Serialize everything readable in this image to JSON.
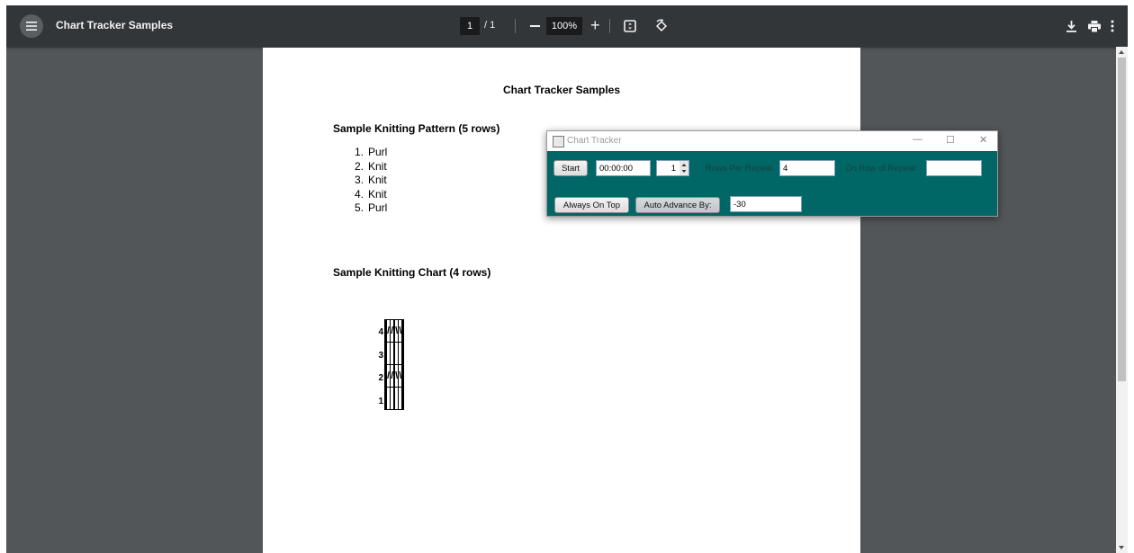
{
  "viewer": {
    "title": "Chart Tracker Samples",
    "current_page": "1",
    "page_separator": "/ 1",
    "zoom": "100%"
  },
  "document": {
    "title": "Chart Tracker Samples",
    "pattern_heading": "Sample Knitting Pattern (5 rows)",
    "pattern_rows": [
      {
        "num": "1.",
        "text": "Purl"
      },
      {
        "num": "2.",
        "text": "Knit"
      },
      {
        "num": "3.",
        "text": "Knit"
      },
      {
        "num": "4.",
        "text": "Knit"
      },
      {
        "num": "5.",
        "text": "Purl"
      }
    ],
    "chart_heading": "Sample Knitting Chart (4 rows)",
    "chart_rows": [
      {
        "label": "4",
        "cells": [
          "",
          "",
          "/",
          "/",
          "",
          "\\",
          "\\",
          "",
          ""
        ]
      },
      {
        "label": "3",
        "cells": [
          "",
          "",
          "",
          "",
          "",
          "",
          "",
          "",
          ""
        ]
      },
      {
        "label": "2",
        "cells": [
          "",
          "",
          "/",
          "/",
          "",
          "\\",
          "\\",
          "",
          ""
        ]
      },
      {
        "label": "1",
        "cells": [
          "",
          "",
          "",
          "",
          "",
          "",
          "",
          "",
          ""
        ]
      }
    ]
  },
  "app": {
    "title": "Chart Tracker",
    "start_label": "Start",
    "timer_value": "00:00:00",
    "spinner_value": "1",
    "rows_per_repeat_label": "Rows Per Repeat",
    "rows_per_repeat_value": "4",
    "on_row_label": "On Row of Repeat",
    "on_row_value": "",
    "always_on_top_label": "Always On Top",
    "auto_advance_label": "Auto Advance By:",
    "auto_advance_value": "-30",
    "minimize": "—",
    "maximize": "☐",
    "close": "✕"
  },
  "icons": {
    "menu": "menu-icon",
    "fit": "fit-page-icon",
    "rotate": "rotate-icon",
    "download": "download-icon",
    "print": "print-icon",
    "more": "more-vertical-icon"
  }
}
